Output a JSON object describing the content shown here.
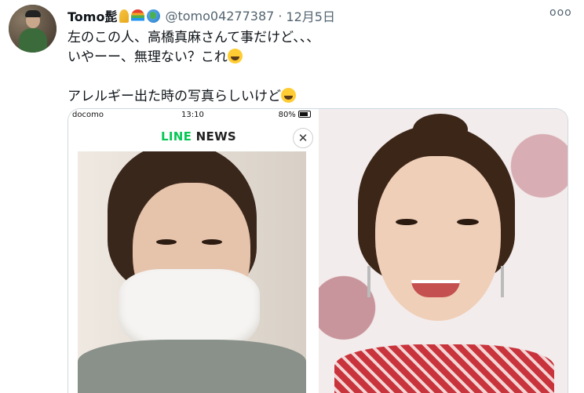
{
  "tweet": {
    "author_name": "Tomo髭",
    "handle": "@tomo04277387",
    "separator": "·",
    "date": "12月5日",
    "more_label": "ooo",
    "line1": "左のこの人、高橋真麻さんて事だけど、、、",
    "line2": "いやーー、無理ない？これ",
    "line3": "アレルギー出た時の写真らしいけど",
    "author_emojis": [
      "ribbon-emoji",
      "rainbow-emoji",
      "earth-emoji"
    ],
    "text_emojis": [
      "rofl-emoji",
      "sweat-smile-emoji"
    ]
  },
  "media": {
    "left": {
      "status_carrier": "docomo",
      "status_time": "13:10",
      "status_battery": "80%",
      "app_logo_green": "LINE",
      "app_logo_dark": " NEWS",
      "close_label": "✕"
    }
  },
  "colors": {
    "text": "#0f1419",
    "secondary": "#536471",
    "line_green": "#06c755",
    "border": "#cfd9de"
  }
}
